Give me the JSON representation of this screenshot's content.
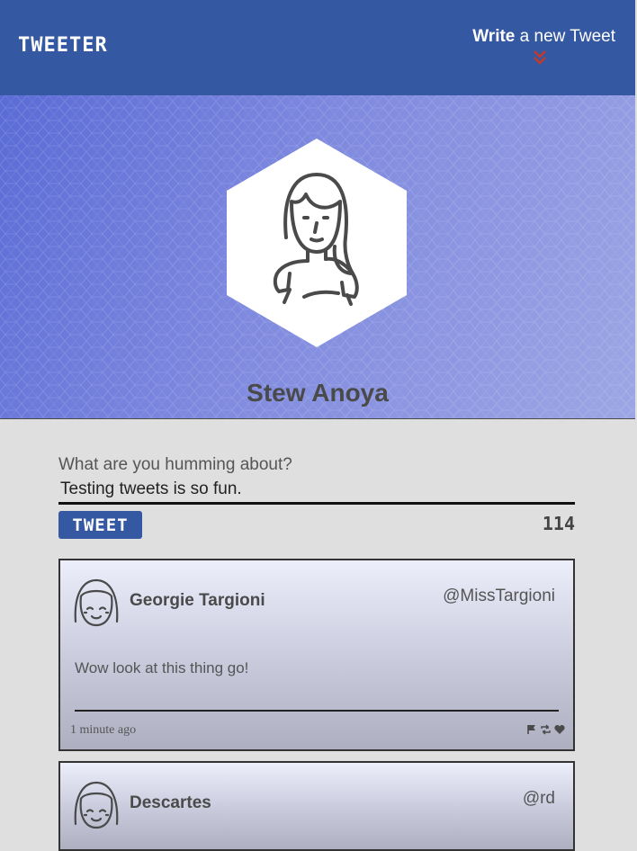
{
  "nav": {
    "brand": "TWEETER",
    "compose_bold": "Write",
    "compose_rest": " a new Tweet"
  },
  "profile": {
    "name": "Stew Anoya"
  },
  "composer": {
    "prompt": "What are you humming about?",
    "text": "Testing tweets is so fun.",
    "button_label": "TWEET",
    "counter": "114"
  },
  "tweets": [
    {
      "name": "Georgie Targioni",
      "handle": "@MissTargioni",
      "body": "Wow look at this thing go!",
      "time": "1 minute ago"
    },
    {
      "name": "Descartes",
      "handle": "@rd"
    }
  ],
  "colors": {
    "nav_bg": "#3558a2",
    "accent_chevron": "#c0392b",
    "page_bg": "#dfdfdf"
  }
}
